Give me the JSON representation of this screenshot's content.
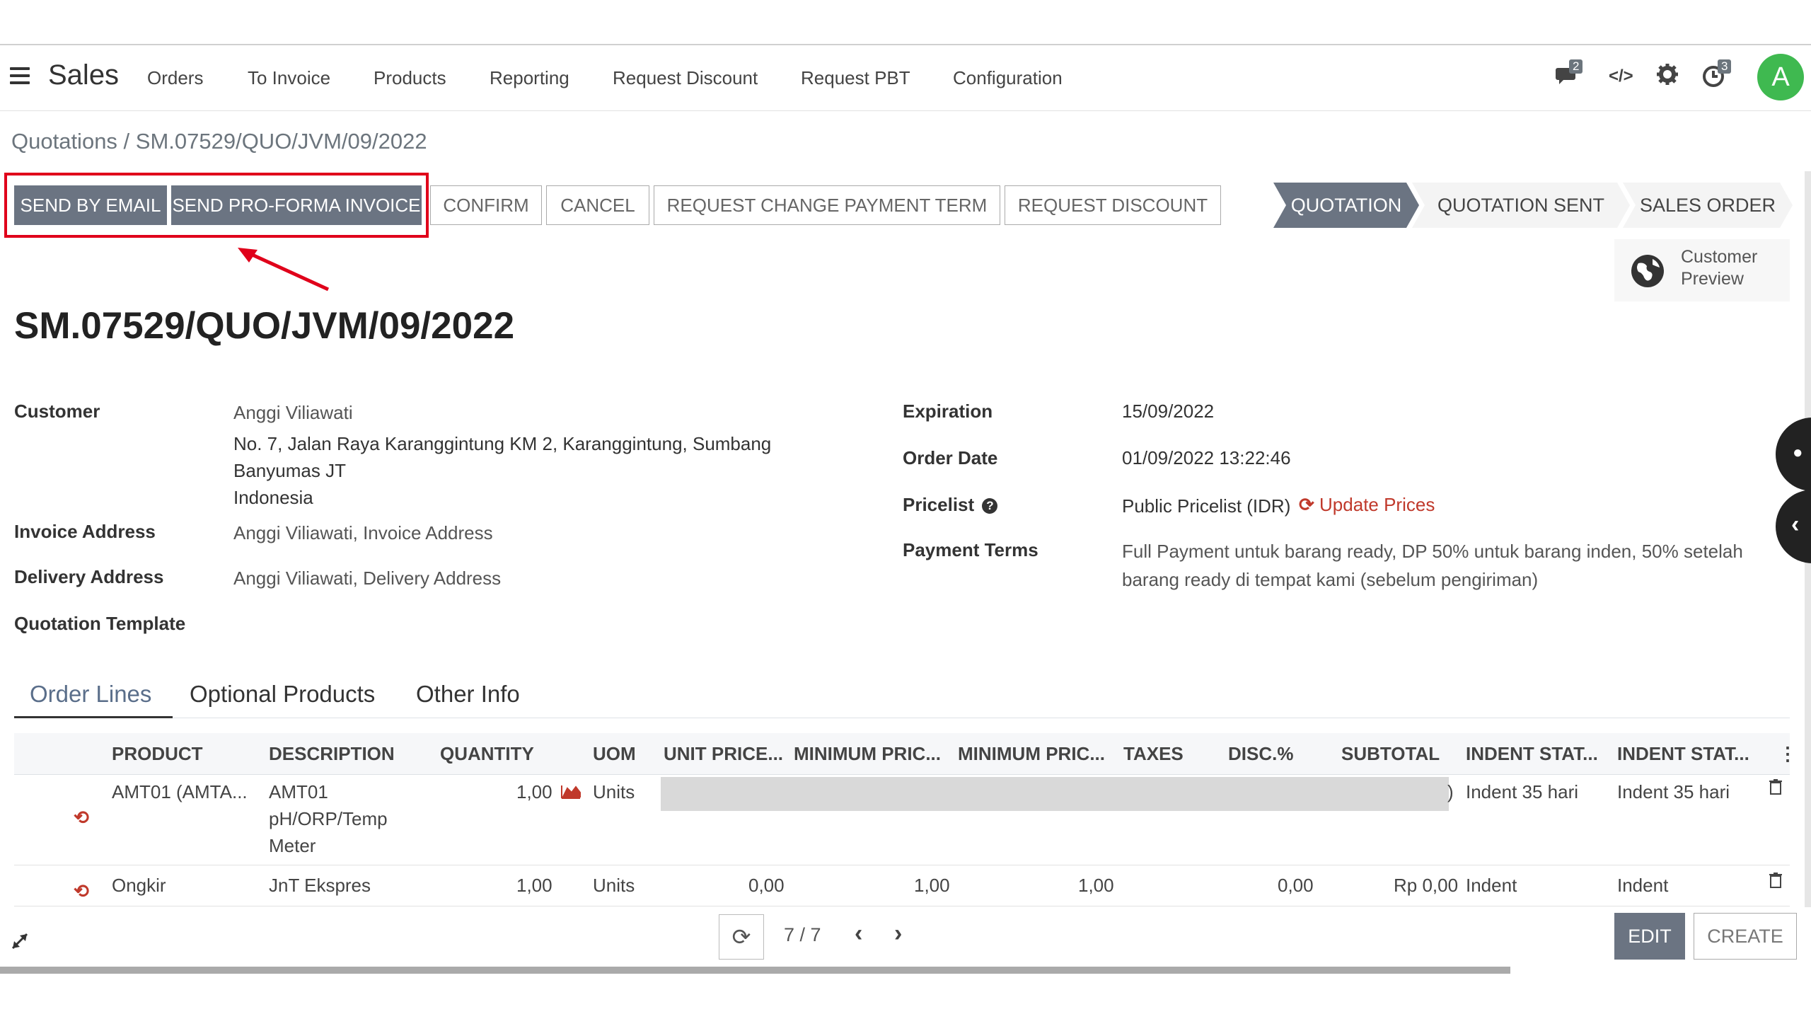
{
  "nav": {
    "app_title": "Sales",
    "menu": [
      "Orders",
      "To Invoice",
      "Products",
      "Reporting",
      "Request Discount",
      "Request PBT",
      "Configuration"
    ],
    "messages_badge": "2",
    "activities_badge": "3",
    "avatar_letter": "A"
  },
  "breadcrumb": "Quotations / SM.07529/QUO/JVM/09/2022",
  "actions": {
    "send_email": "SEND BY EMAIL",
    "send_proforma": "SEND PRO-FORMA INVOICE",
    "confirm": "CONFIRM",
    "cancel": "CANCEL",
    "request_change_payment": "REQUEST CHANGE PAYMENT TERM",
    "request_discount": "REQUEST DISCOUNT"
  },
  "stages": {
    "quotation": "QUOTATION",
    "quotation_sent": "QUOTATION SENT",
    "sales_order": "SALES ORDER"
  },
  "customer_preview": {
    "line1": "Customer",
    "line2": "Preview"
  },
  "doc_title": "SM.07529/QUO/JVM/09/2022",
  "left_fields": {
    "customer_label": "Customer",
    "customer_name": "Anggi Viliawati",
    "address1": "No. 7, Jalan Raya Karanggintung KM 2, Karanggintung, Sumbang",
    "address2": "Banyumas JT",
    "address3": "Indonesia",
    "invoice_label": "Invoice Address",
    "invoice_value": "Anggi Viliawati, Invoice Address",
    "delivery_label": "Delivery Address",
    "delivery_value": "Anggi Viliawati, Delivery Address",
    "template_label": "Quotation Template"
  },
  "right_fields": {
    "expiration_label": "Expiration",
    "expiration_value": "15/09/2022",
    "order_date_label": "Order Date",
    "order_date_value": "01/09/2022 13:22:46",
    "pricelist_label": "Pricelist",
    "pricelist_value": "Public Pricelist (IDR)",
    "update_prices": "Update Prices",
    "payment_label": "Payment Terms",
    "payment_line1": "Full Payment untuk barang ready, DP 50% untuk barang inden, 50% setelah",
    "payment_line2": "barang ready di tempat kami (sebelum pengiriman)"
  },
  "tabs": [
    "Order Lines",
    "Optional Products",
    "Other Info"
  ],
  "table": {
    "headers": [
      "PRODUCT",
      "DESCRIPTION",
      "QUANTITY",
      "UOM",
      "UNIT PRICE...",
      "MINIMUM PRIC...",
      "MINIMUM PRIC...",
      "TAXES",
      "DISC.%",
      "SUBTOTAL",
      "INDENT STAT...",
      "INDENT STAT..."
    ],
    "rows": [
      {
        "product": "AMT01 (AMTA...",
        "desc1": "AMT01",
        "desc2": "pH/ORP/Temp",
        "desc3": "Meter",
        "quantity": "1,00",
        "uom": "Units",
        "partial": ")",
        "indent1": "Indent 35 hari",
        "indent2": "Indent 35 hari"
      },
      {
        "product": "Ongkir",
        "desc1": "JnT Ekspres",
        "quantity": "1,00",
        "uom": "Units",
        "unit_price": "0,00",
        "min_price1": "1,00",
        "min_price2": "1,00",
        "disc": "0,00",
        "subtotal": "Rp 0,00",
        "indent1": "Indent",
        "indent2": "Indent"
      }
    ]
  },
  "pager": "7 / 7",
  "bottom": {
    "edit": "EDIT",
    "create": "CREATE"
  },
  "colors": {
    "primary": "#6b7482",
    "highlight": "#e0001a",
    "accent": "#c0392b",
    "avatar": "#3fb950"
  }
}
